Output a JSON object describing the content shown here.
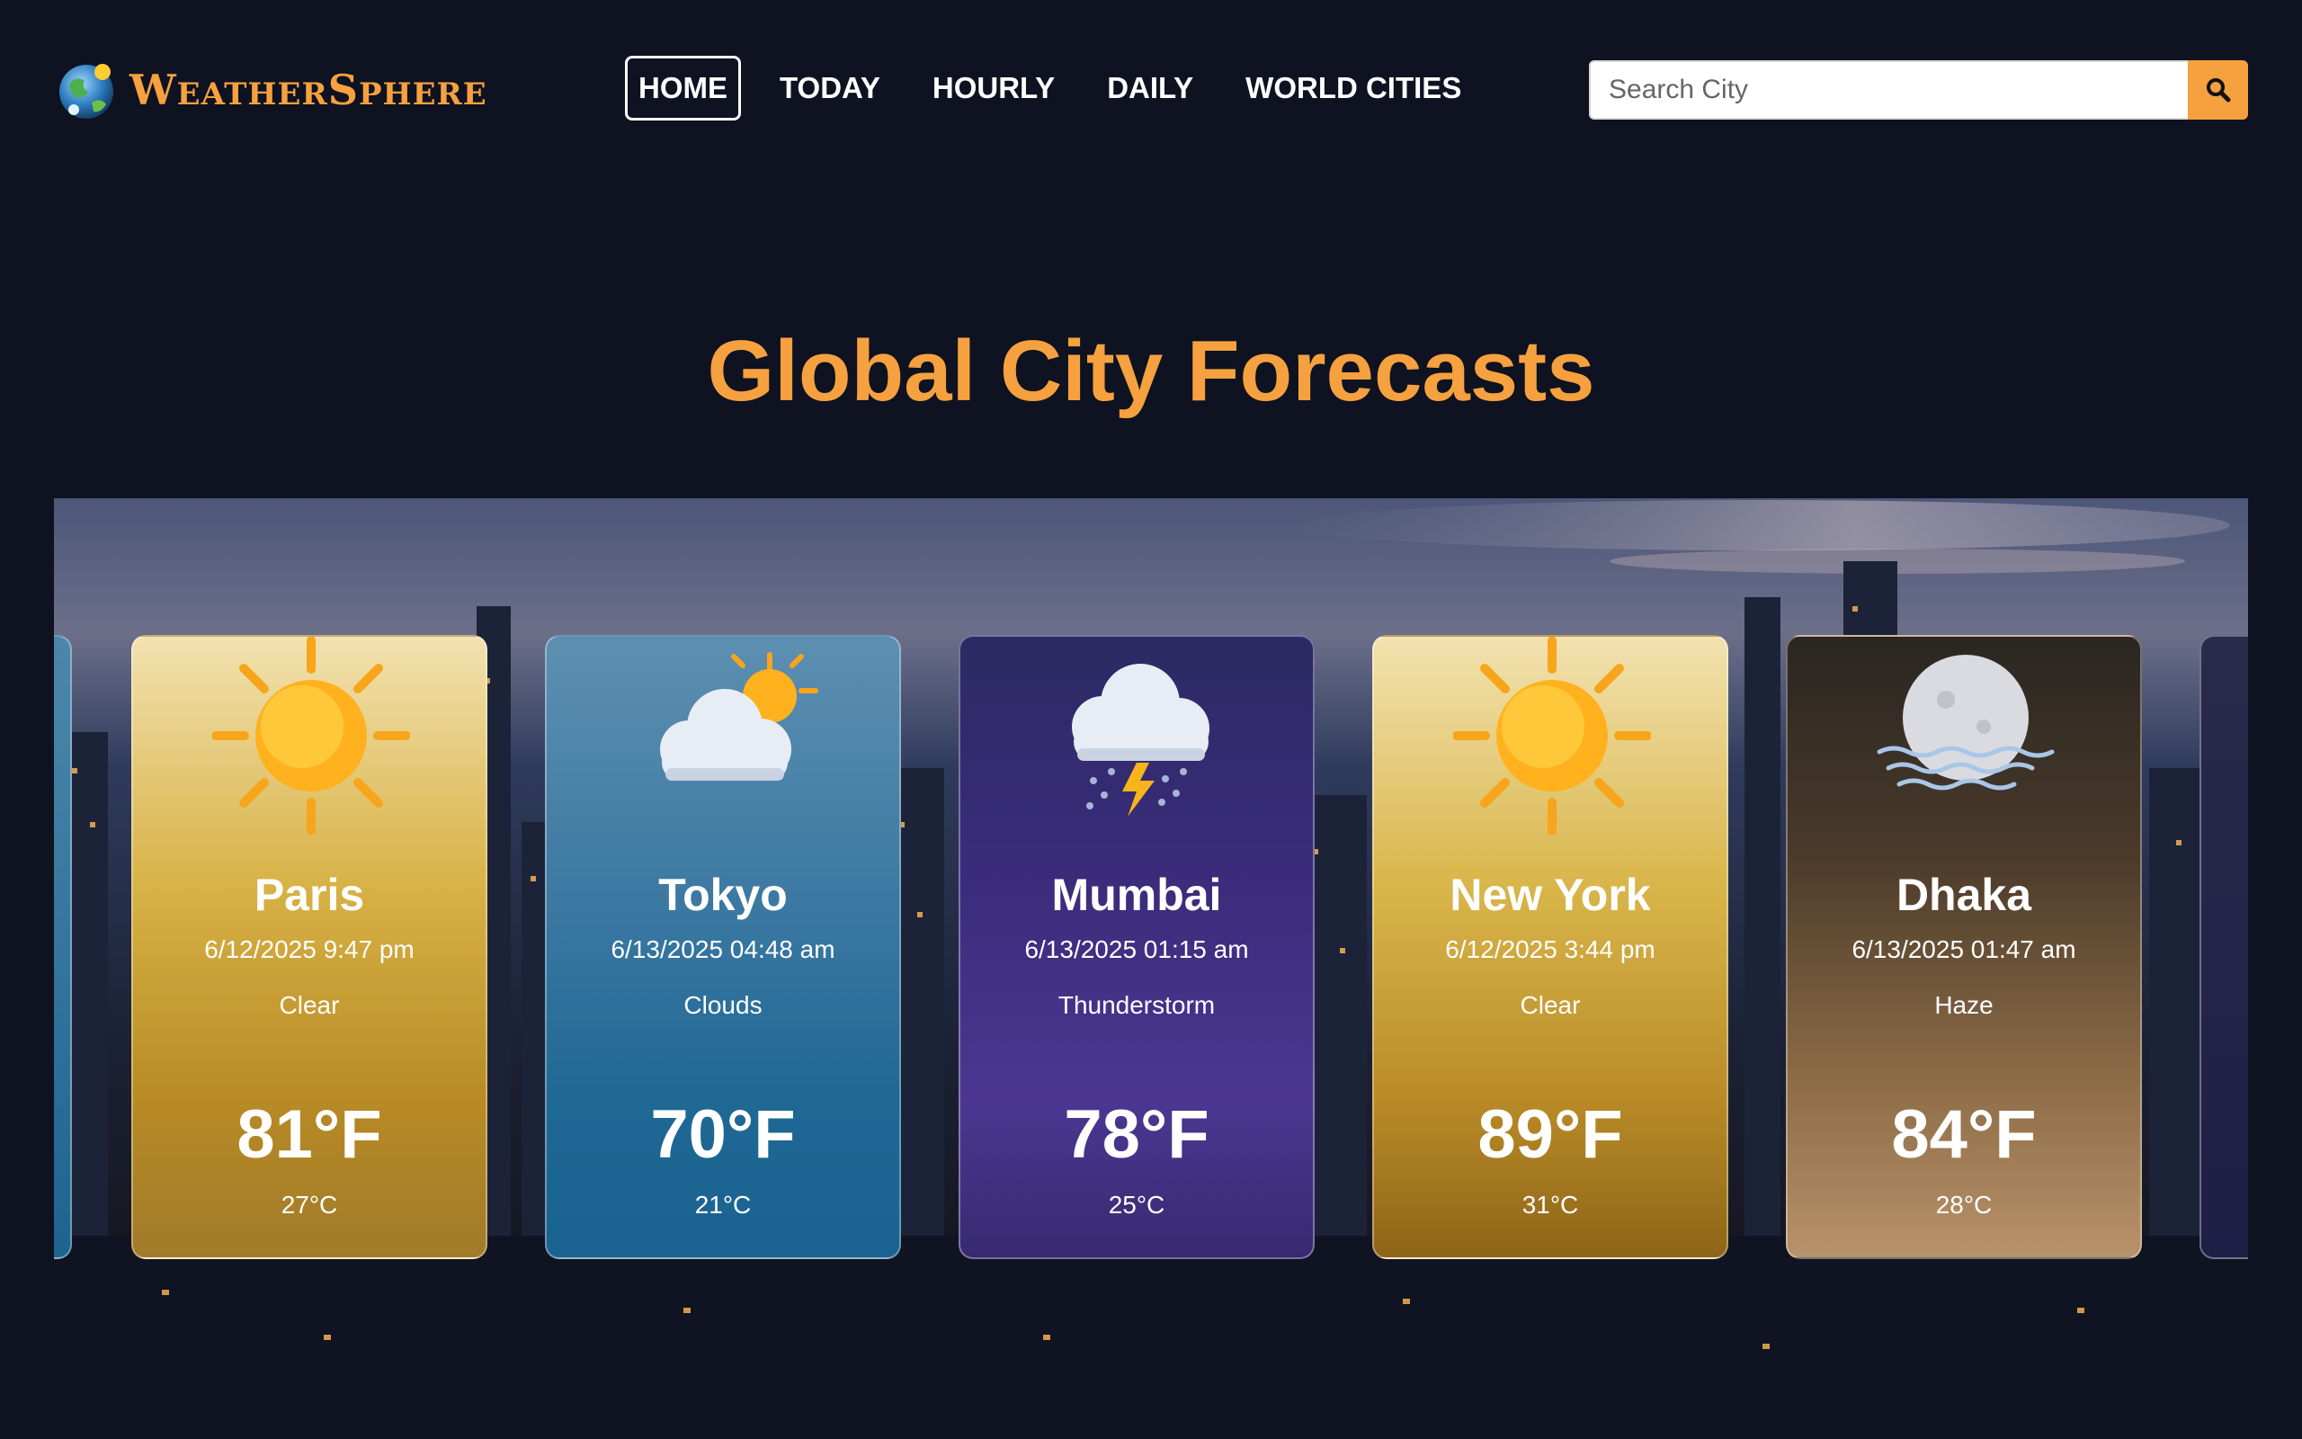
{
  "app": {
    "brand_first": "W",
    "brand_rest1": "EATHER",
    "brand_second": "S",
    "brand_rest2": "PHERE",
    "accent_color": "#f6a13f",
    "background_color": "#0f1220"
  },
  "nav": {
    "items": [
      {
        "label": "HOME",
        "active": true
      },
      {
        "label": "TODAY",
        "active": false
      },
      {
        "label": "HOURLY",
        "active": false
      },
      {
        "label": "DAILY",
        "active": false
      },
      {
        "label": "WORLD CITIES",
        "active": false
      }
    ]
  },
  "search": {
    "placeholder": "Search City",
    "value": "",
    "button_icon": "search-icon"
  },
  "page": {
    "heading": "Global City Forecasts"
  },
  "cities": [
    {
      "city": "Paris",
      "datetime": "6/12/2025 9:47 pm",
      "condition": "Clear",
      "temp_f": "81°F",
      "temp_c": "27°C",
      "icon": "sun-icon"
    },
    {
      "city": "Tokyo",
      "datetime": "6/13/2025 04:48 am",
      "condition": "Clouds",
      "temp_f": "70°F",
      "temp_c": "21°C",
      "icon": "cloud-sun-icon"
    },
    {
      "city": "Mumbai",
      "datetime": "6/13/2025 01:15 am",
      "condition": "Thunderstorm",
      "temp_f": "78°F",
      "temp_c": "25°C",
      "icon": "thunderstorm-icon"
    },
    {
      "city": "New York",
      "datetime": "6/12/2025 3:44 pm",
      "condition": "Clear",
      "temp_f": "89°F",
      "temp_c": "31°C",
      "icon": "sun-icon"
    },
    {
      "city": "Dhaka",
      "datetime": "6/13/2025 01:47 am",
      "condition": "Haze",
      "temp_f": "84°F",
      "temp_c": "28°C",
      "icon": "haze-moon-icon"
    }
  ]
}
